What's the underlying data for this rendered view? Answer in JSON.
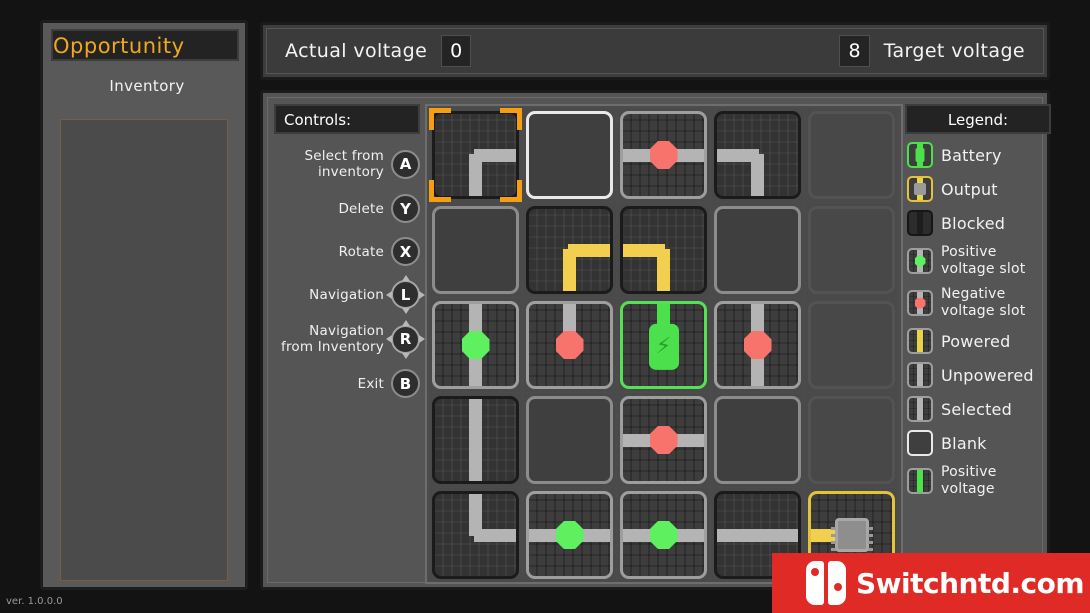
{
  "inventory": {
    "title": "Opportunity",
    "subtitle": "Inventory",
    "items": []
  },
  "header": {
    "actual_label": "Actual voltage",
    "actual_value": "0",
    "target_value": "8",
    "target_label": "Target voltage"
  },
  "controls": {
    "heading": "Controls:",
    "items": [
      {
        "label": "Select from inventory",
        "button": "A",
        "dpad": false
      },
      {
        "label": "Delete",
        "button": "Y",
        "dpad": false
      },
      {
        "label": "Rotate",
        "button": "X",
        "dpad": false
      },
      {
        "label": "Navigation",
        "button": "L",
        "dpad": true
      },
      {
        "label": "Navigation from Inventory",
        "button": "R",
        "dpad": true
      },
      {
        "label": "Exit",
        "button": "B",
        "dpad": false
      }
    ]
  },
  "legend": {
    "heading": "Legend:",
    "items": [
      {
        "label": "Battery",
        "icon": "battery-icon",
        "color": "#4ce04c"
      },
      {
        "label": "Output",
        "icon": "output-chip-icon",
        "color": "#e3c33a"
      },
      {
        "label": "Blocked",
        "icon": "blocked-tile-icon",
        "color": "#161616"
      },
      {
        "label": "Positive voltage slot",
        "icon": "positive-slot-icon",
        "color": "#5ef05e"
      },
      {
        "label": "Negative voltage slot",
        "icon": "negative-slot-icon",
        "color": "#f8736b"
      },
      {
        "label": "Powered",
        "icon": "powered-tile-icon",
        "color": "#e8d24a"
      },
      {
        "label": "Unpowered",
        "icon": "unpowered-tile-icon",
        "color": "#b4b4b4"
      },
      {
        "label": "Selected",
        "icon": "selected-tile-icon",
        "color": "#9e9e9e"
      },
      {
        "label": "Blank",
        "icon": "blank-tile-icon",
        "color": "#e9e9e9"
      },
      {
        "label": "Positive voltage",
        "icon": "positive-voltage-icon",
        "color": "#4ce04c"
      }
    ]
  },
  "board": {
    "columns": 5,
    "rows": 5,
    "selected_cell": {
      "row": 0,
      "col": 0
    },
    "cells": [
      {
        "r": 0,
        "c": 0,
        "type": "circuit-dark",
        "selected": true,
        "wires": [
          "vb",
          "hr"
        ],
        "wire_color": "grey"
      },
      {
        "r": 0,
        "c": 1,
        "type": "blank-bright",
        "wires": []
      },
      {
        "r": 0,
        "c": 2,
        "type": "circuit",
        "wires": [
          "hl",
          "hr"
        ],
        "node": "negative"
      },
      {
        "r": 0,
        "c": 3,
        "type": "circuit-dark",
        "wires": [
          "hl",
          "vb"
        ],
        "wire_color": "grey"
      },
      {
        "r": 0,
        "c": 4,
        "type": "faded",
        "wires": []
      },
      {
        "r": 1,
        "c": 0,
        "type": "blank",
        "wires": []
      },
      {
        "r": 1,
        "c": 1,
        "type": "circuit-dark",
        "wires": [
          "vb",
          "hr"
        ],
        "wire_color": "yellow"
      },
      {
        "r": 1,
        "c": 2,
        "type": "circuit-dark",
        "wires": [
          "hl",
          "vb"
        ],
        "wire_color": "yellow"
      },
      {
        "r": 1,
        "c": 3,
        "type": "blank",
        "wires": []
      },
      {
        "r": 1,
        "c": 4,
        "type": "faded",
        "wires": []
      },
      {
        "r": 2,
        "c": 0,
        "type": "circuit",
        "wires": [
          "v"
        ],
        "node": "positive"
      },
      {
        "r": 2,
        "c": 1,
        "type": "circuit",
        "wires": [
          "vt"
        ],
        "node": "negative"
      },
      {
        "r": 2,
        "c": 2,
        "type": "battery",
        "wires": [
          "vt"
        ],
        "wire_color": "green"
      },
      {
        "r": 2,
        "c": 3,
        "type": "circuit",
        "wires": [
          "v"
        ],
        "node": "negative"
      },
      {
        "r": 2,
        "c": 4,
        "type": "faded",
        "wires": []
      },
      {
        "r": 3,
        "c": 0,
        "type": "circuit-dark",
        "wires": [
          "v"
        ],
        "wire_color": "grey"
      },
      {
        "r": 3,
        "c": 1,
        "type": "blank",
        "wires": []
      },
      {
        "r": 3,
        "c": 2,
        "type": "circuit",
        "wires": [
          "hl",
          "hr"
        ],
        "node": "negative"
      },
      {
        "r": 3,
        "c": 3,
        "type": "blank",
        "wires": []
      },
      {
        "r": 3,
        "c": 4,
        "type": "faded",
        "wires": []
      },
      {
        "r": 4,
        "c": 0,
        "type": "circuit-dark",
        "wires": [
          "vt",
          "hr"
        ],
        "wire_color": "grey"
      },
      {
        "r": 4,
        "c": 1,
        "type": "circuit",
        "wires": [
          "hl",
          "hr"
        ],
        "node": "positive"
      },
      {
        "r": 4,
        "c": 2,
        "type": "circuit",
        "wires": [
          "hl",
          "hr"
        ],
        "node": "positive"
      },
      {
        "r": 4,
        "c": 3,
        "type": "circuit-dark",
        "wires": [
          "hl",
          "hr"
        ],
        "wire_color": "grey"
      },
      {
        "r": 4,
        "c": 4,
        "type": "output",
        "wires": [
          "hl"
        ],
        "wire_color": "yellow"
      }
    ]
  },
  "watermark": {
    "text": "Switchntd.com",
    "color": "#e02a26"
  },
  "version": "ver. 1.0.0.0"
}
